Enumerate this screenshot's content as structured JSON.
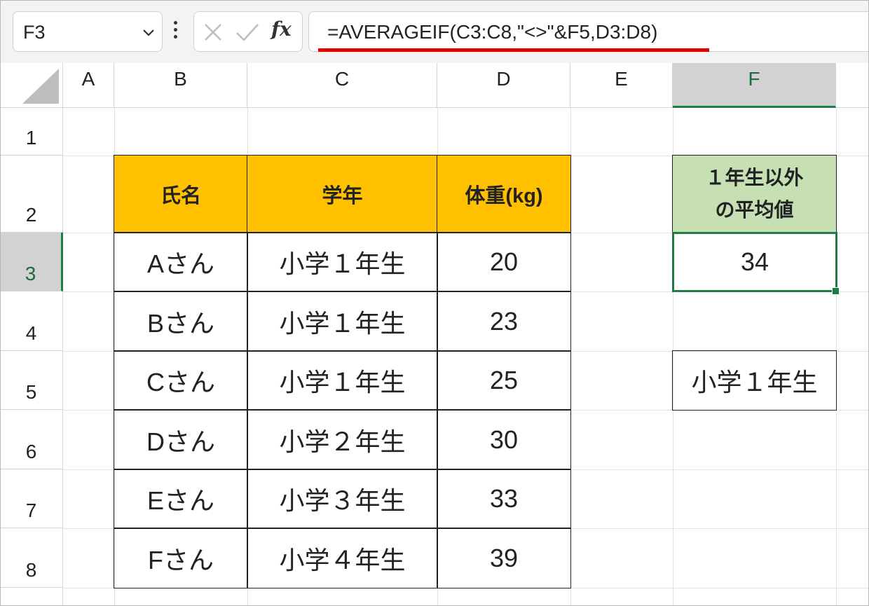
{
  "name_box": {
    "value": "F3"
  },
  "formula_bar": {
    "formula": "=AVERAGEIF(C3:C8,\"<>\"&F5,D3:D8)"
  },
  "colors": {
    "header_fill": "#ffc000",
    "label_fill": "#c6e0b4",
    "active_border": "#1e7d45",
    "underline": "#e60000"
  },
  "columns": [
    "A",
    "B",
    "C",
    "D",
    "E",
    "F"
  ],
  "rows": [
    "1",
    "2",
    "3",
    "4",
    "5",
    "6",
    "7",
    "8"
  ],
  "selected_column": "F",
  "selected_row": "3",
  "table": {
    "headers": [
      "氏名",
      "学年",
      "体重(kg)"
    ],
    "rows": [
      [
        "Aさん",
        "小学１年生",
        "20"
      ],
      [
        "Bさん",
        "小学１年生",
        "23"
      ],
      [
        "Cさん",
        "小学１年生",
        "25"
      ],
      [
        "Dさん",
        "小学２年生",
        "30"
      ],
      [
        "Eさん",
        "小学３年生",
        "33"
      ],
      [
        "Fさん",
        "小学４年生",
        "39"
      ]
    ]
  },
  "result": {
    "label_line1": "１年生以外",
    "label_line2": "の平均値",
    "value": "34",
    "criteria": "小学１年生"
  }
}
